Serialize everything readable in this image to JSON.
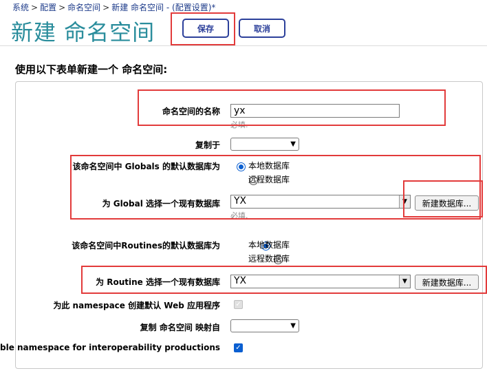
{
  "breadcrumb": {
    "items": [
      "系统",
      "配置",
      "命名空间",
      "新建 命名空间"
    ],
    "separator": ">",
    "suffix": " - (配置设置)*"
  },
  "header": {
    "title": "新建 命名空间",
    "save_label": "保存",
    "cancel_label": "取消"
  },
  "form": {
    "heading": "使用以下表单新建一个 命名空间:",
    "name_label": "命名空间的名称",
    "name_value": "yx",
    "required_hint": "必填.",
    "copy_from_label": "复制于",
    "copy_from_value": "",
    "globals_db_label": "该命名空间中 Globals 的默认数据库为",
    "routines_db_label": "该命名空间中Routines的默认数据库为",
    "local_db_option": "本地数据库",
    "remote_db_option": "远程数据库",
    "global_select_label": "为 Global 选择一个现有数据库",
    "global_select_value": "YX",
    "routine_select_label": "为 Routine 选择一个现有数据库",
    "routine_select_value": "YX",
    "new_db_button": "新建数据库...",
    "web_app_label": "为此 namespace 创建默认 Web 应用程序",
    "web_app_checked": true,
    "map_from_label": "复制 命名空间 映射自",
    "map_from_value": "",
    "interop_label": "Enable namespace for interoperability productions",
    "interop_checked": true
  },
  "colors": {
    "title": "#2a8d9c",
    "link": "#1d3b8a",
    "button_border": "#2b3f9a",
    "highlight_box": "#e23a3a",
    "checked": "#0a5fd1"
  }
}
